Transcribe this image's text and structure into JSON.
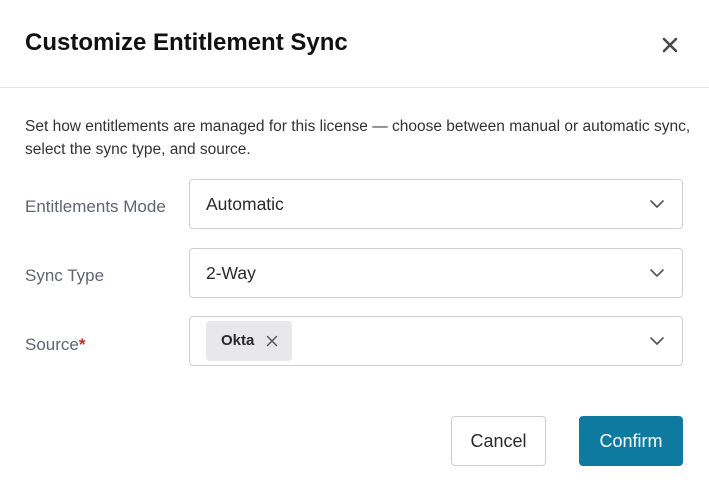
{
  "dialog": {
    "title": "Customize Entitlement Sync",
    "description": "Set how entitlements are managed for this license — choose between manual or automatic sync, select the sync type, and source.",
    "close_icon": "close-icon"
  },
  "fields": {
    "entitlements_mode": {
      "label": "Entitlements Mode",
      "value": "Automatic"
    },
    "sync_type": {
      "label": "Sync Type",
      "value": "2-Way"
    },
    "source": {
      "label": "Source",
      "required_marker": "*",
      "chips": [
        "Okta"
      ]
    }
  },
  "buttons": {
    "cancel_label": "Cancel",
    "confirm_label": "Confirm"
  },
  "colors": {
    "primary": "#0f7aa0",
    "required": "#c62828"
  }
}
